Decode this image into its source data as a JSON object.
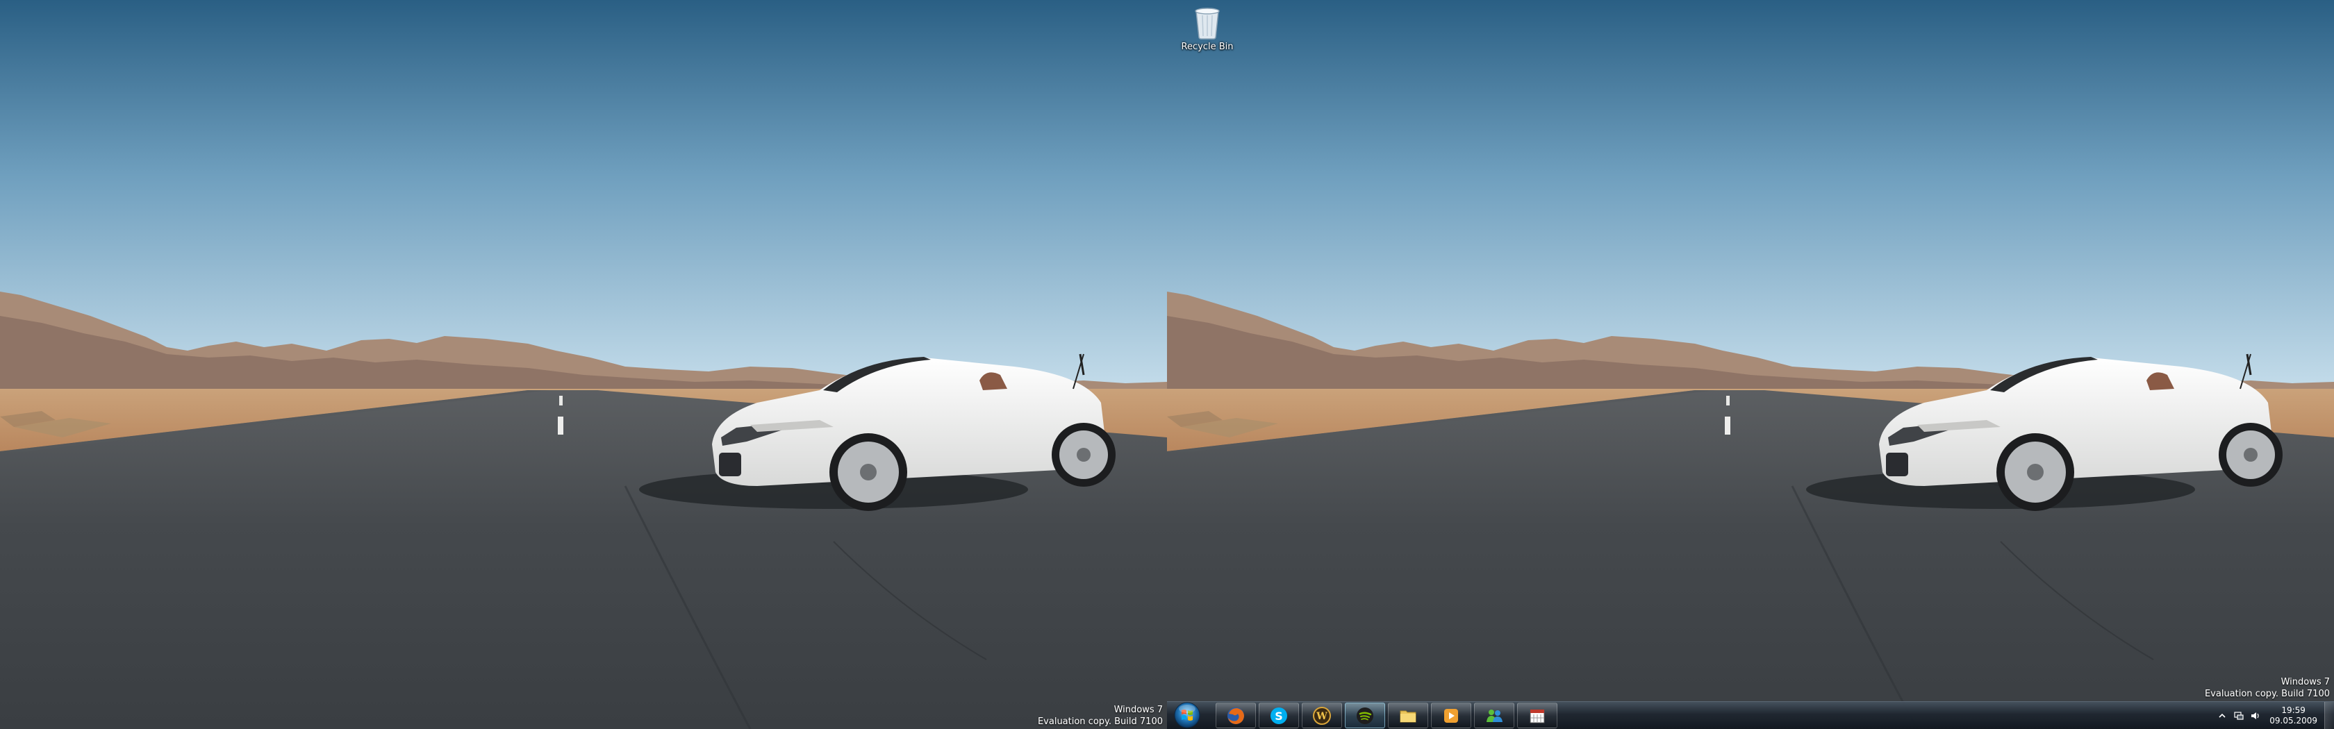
{
  "desktop": {
    "recycle_bin_label": "Recycle Bin",
    "watermark": {
      "line1": "Windows 7",
      "line2": "Evaluation copy. Build 7100"
    }
  },
  "taskbar": {
    "start_icon": "windows-orb-icon",
    "buttons": [
      {
        "icon": "firefox-icon"
      },
      {
        "icon": "skype-icon"
      },
      {
        "icon": "warcraft-icon"
      },
      {
        "icon": "spotify-icon",
        "active": true
      },
      {
        "icon": "folder-icon"
      },
      {
        "icon": "media-player-icon"
      },
      {
        "icon": "messenger-icon"
      },
      {
        "icon": "calendar-icon"
      }
    ],
    "tray": {
      "icons": [
        "show-hidden-icons-icon",
        "network-icon",
        "volume-icon"
      ],
      "time": "19:59",
      "date": "09.05.2009"
    }
  },
  "colors": {
    "sky_top": "#2c6185",
    "sky_horizon": "#bcd7e6",
    "road": "#3f4347",
    "sand": "#c9a47c",
    "car": "#f0f0ee"
  }
}
